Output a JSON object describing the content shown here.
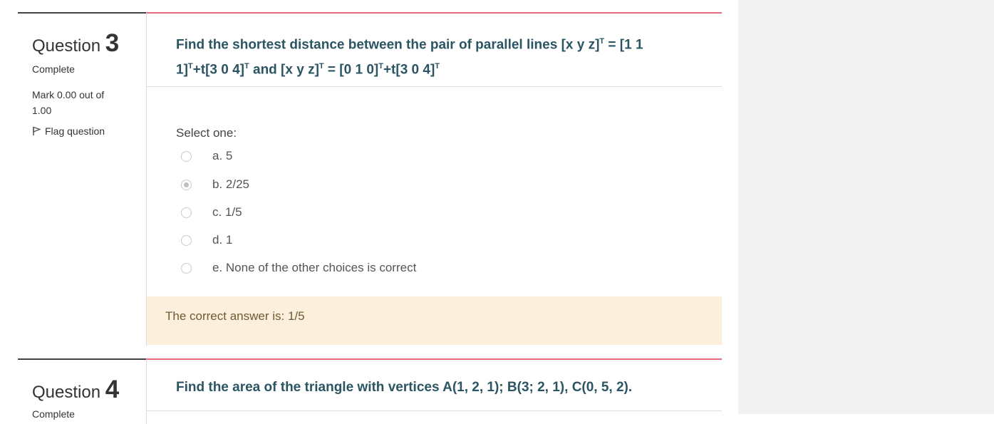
{
  "question3": {
    "label": "Question",
    "number": "3",
    "state": "Complete",
    "grade": "Mark 0.00 out of 1.00",
    "flag_label": "Flag question",
    "text_parts": {
      "a": "Find the shortest distance between the pair of parallel lines [x  y  z]",
      "b": " = [1  1  1]",
      "c": "+t[3  0  4]",
      "d": " and  [x  y  z]",
      "e": " = [0  1  0]",
      "f": "+t[3  0  4]",
      "sup": "T"
    },
    "prompt": "Select one:",
    "options": [
      {
        "label": "a. 5",
        "selected": false
      },
      {
        "label": "b. 2/25",
        "selected": true
      },
      {
        "label": "c. 1/5",
        "selected": false
      },
      {
        "label": "d. 1",
        "selected": false
      },
      {
        "label": "e. None of the other choices is correct",
        "selected": false
      }
    ],
    "feedback": "The correct answer is: 1/5"
  },
  "question4": {
    "label": "Question",
    "number": "4",
    "state": "Complete",
    "text": "Find the area of the triangle with vertices A(1, 2, 1); B(3; 2, 1), C(0, 5, 2)."
  },
  "colors": {
    "accent": "#e76a7d",
    "question_text": "#2b5563",
    "feedback_bg": "#fcefdc"
  },
  "icons": {
    "flag": "flag-icon"
  }
}
